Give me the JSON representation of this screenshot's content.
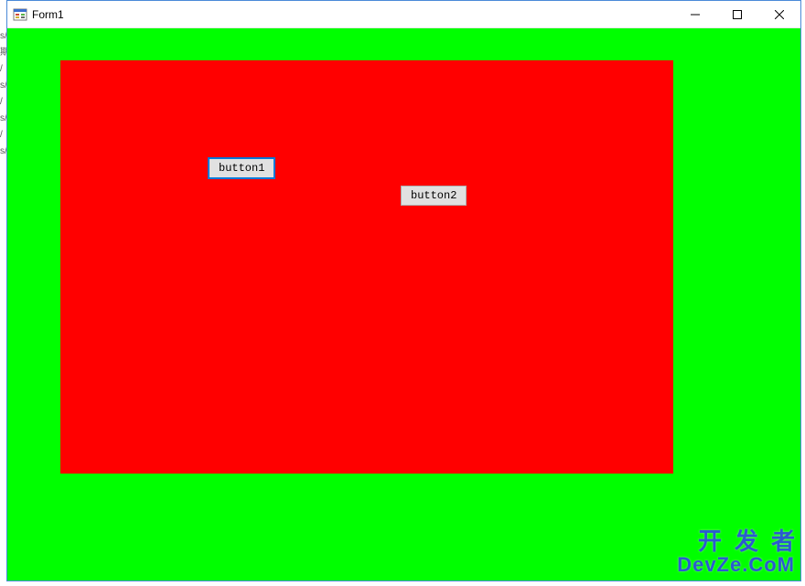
{
  "window": {
    "title": "Form1"
  },
  "form": {
    "background_color": "#00ff00",
    "panel": {
      "background_color": "#ff0000"
    },
    "buttons": {
      "button1": {
        "label": "button1",
        "focused": true
      },
      "button2": {
        "label": "button2",
        "focused": false
      }
    }
  },
  "sidebar_fragments": [
    "s/",
    "期",
    "/",
    "s/",
    "/",
    "s/",
    "/",
    "s/"
  ],
  "watermark": {
    "line1": "开发者",
    "line2": "DevZe.CoM"
  }
}
